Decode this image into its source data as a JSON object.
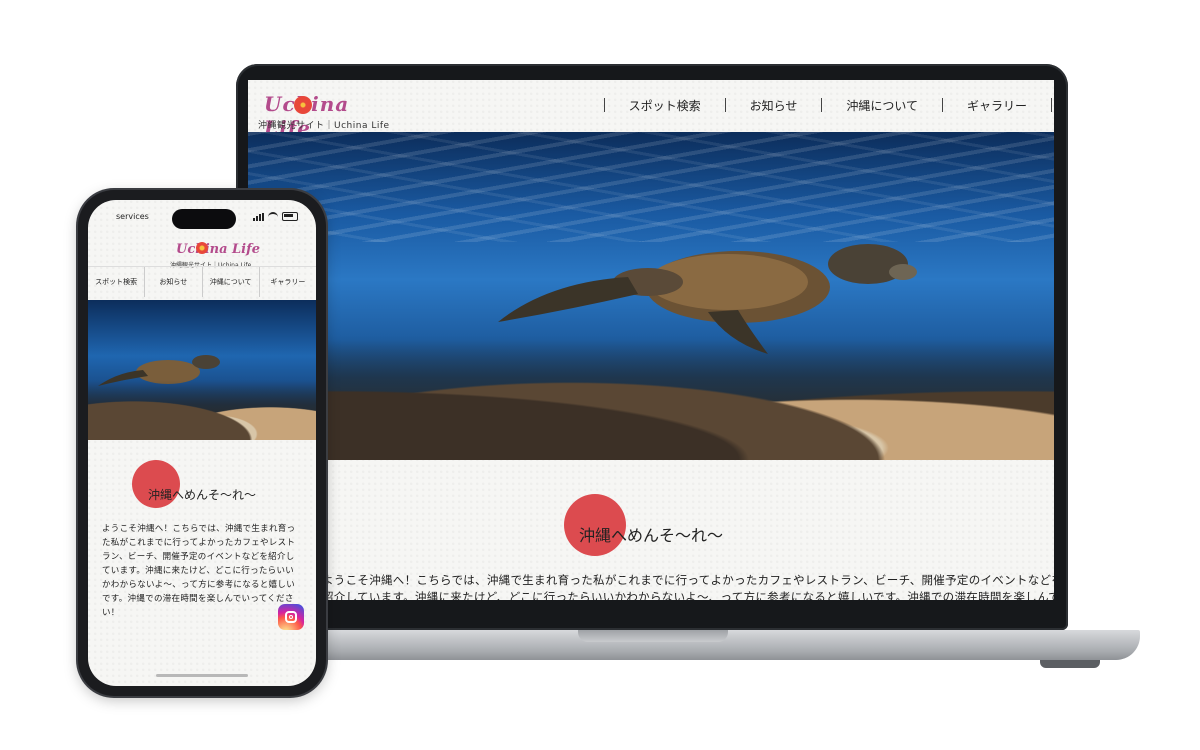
{
  "site": {
    "logo_text": "Uchina Life",
    "tagline": "沖縄観光サイト｜Uchina Life"
  },
  "nav": {
    "items": [
      {
        "label": "スポット検索"
      },
      {
        "label": "お知らせ"
      },
      {
        "label": "沖縄について"
      },
      {
        "label": "ギャラリー"
      }
    ]
  },
  "hero": {
    "image": "sea-turtle-coral-reef-photo"
  },
  "welcome": {
    "heading": "沖縄へめんそ〜れ〜",
    "desktop_lines": [
      "ようこそ沖縄へ！こちらでは、沖縄で生まれ育った私がこれまでに行ってよかったカフェやレストラン、ビーチ、開催予定のイベントなどを",
      "紹介しています。沖縄に来たけど、どこに行ったらいいかわからないよ〜、って方に参考になると嬉しいです。沖縄での滞在時間を楽しんで"
    ],
    "mobile_lines": [
      "ようこそ沖縄へ！こちらでは、沖縄で生まれ育っ",
      "た私がこれまでに行ってよかったカフェやレスト",
      "ラン、ビーチ、開催予定のイベントなどを紹介し",
      "ています。沖縄に来たけど、どこに行ったらいい",
      "かわからないよ〜、って方に参考になると嬉しい",
      "です。沖縄での滞在時間を楽しんでいってくださ",
      "い！"
    ]
  },
  "phone_status": {
    "carrier": "services"
  },
  "social": {
    "instagram_icon": "instagram-icon"
  },
  "colors": {
    "accent_circle": "#dc4b4f",
    "logo_pink": "#b34b8c",
    "background": "#f6f6f4"
  }
}
